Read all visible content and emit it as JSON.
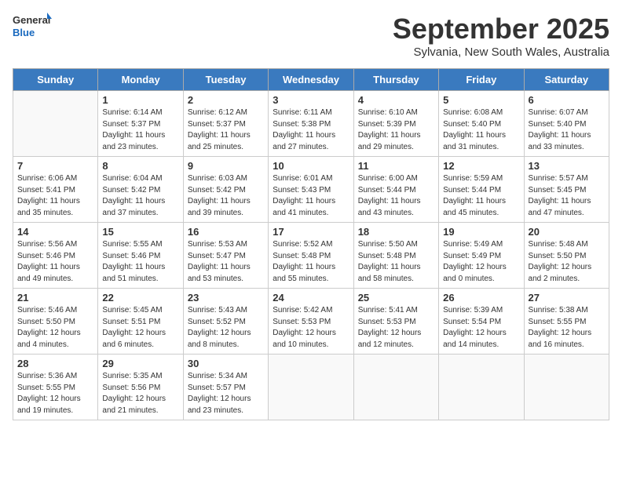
{
  "header": {
    "logo_general": "General",
    "logo_blue": "Blue",
    "month_title": "September 2025",
    "location": "Sylvania, New South Wales, Australia"
  },
  "weekdays": [
    "Sunday",
    "Monday",
    "Tuesday",
    "Wednesday",
    "Thursday",
    "Friday",
    "Saturday"
  ],
  "weeks": [
    [
      {
        "day": "",
        "info": ""
      },
      {
        "day": "1",
        "info": "Sunrise: 6:14 AM\nSunset: 5:37 PM\nDaylight: 11 hours\nand 23 minutes."
      },
      {
        "day": "2",
        "info": "Sunrise: 6:12 AM\nSunset: 5:37 PM\nDaylight: 11 hours\nand 25 minutes."
      },
      {
        "day": "3",
        "info": "Sunrise: 6:11 AM\nSunset: 5:38 PM\nDaylight: 11 hours\nand 27 minutes."
      },
      {
        "day": "4",
        "info": "Sunrise: 6:10 AM\nSunset: 5:39 PM\nDaylight: 11 hours\nand 29 minutes."
      },
      {
        "day": "5",
        "info": "Sunrise: 6:08 AM\nSunset: 5:40 PM\nDaylight: 11 hours\nand 31 minutes."
      },
      {
        "day": "6",
        "info": "Sunrise: 6:07 AM\nSunset: 5:40 PM\nDaylight: 11 hours\nand 33 minutes."
      }
    ],
    [
      {
        "day": "7",
        "info": "Sunrise: 6:06 AM\nSunset: 5:41 PM\nDaylight: 11 hours\nand 35 minutes."
      },
      {
        "day": "8",
        "info": "Sunrise: 6:04 AM\nSunset: 5:42 PM\nDaylight: 11 hours\nand 37 minutes."
      },
      {
        "day": "9",
        "info": "Sunrise: 6:03 AM\nSunset: 5:42 PM\nDaylight: 11 hours\nand 39 minutes."
      },
      {
        "day": "10",
        "info": "Sunrise: 6:01 AM\nSunset: 5:43 PM\nDaylight: 11 hours\nand 41 minutes."
      },
      {
        "day": "11",
        "info": "Sunrise: 6:00 AM\nSunset: 5:44 PM\nDaylight: 11 hours\nand 43 minutes."
      },
      {
        "day": "12",
        "info": "Sunrise: 5:59 AM\nSunset: 5:44 PM\nDaylight: 11 hours\nand 45 minutes."
      },
      {
        "day": "13",
        "info": "Sunrise: 5:57 AM\nSunset: 5:45 PM\nDaylight: 11 hours\nand 47 minutes."
      }
    ],
    [
      {
        "day": "14",
        "info": "Sunrise: 5:56 AM\nSunset: 5:46 PM\nDaylight: 11 hours\nand 49 minutes."
      },
      {
        "day": "15",
        "info": "Sunrise: 5:55 AM\nSunset: 5:46 PM\nDaylight: 11 hours\nand 51 minutes."
      },
      {
        "day": "16",
        "info": "Sunrise: 5:53 AM\nSunset: 5:47 PM\nDaylight: 11 hours\nand 53 minutes."
      },
      {
        "day": "17",
        "info": "Sunrise: 5:52 AM\nSunset: 5:48 PM\nDaylight: 11 hours\nand 55 minutes."
      },
      {
        "day": "18",
        "info": "Sunrise: 5:50 AM\nSunset: 5:48 PM\nDaylight: 11 hours\nand 58 minutes."
      },
      {
        "day": "19",
        "info": "Sunrise: 5:49 AM\nSunset: 5:49 PM\nDaylight: 12 hours\nand 0 minutes."
      },
      {
        "day": "20",
        "info": "Sunrise: 5:48 AM\nSunset: 5:50 PM\nDaylight: 12 hours\nand 2 minutes."
      }
    ],
    [
      {
        "day": "21",
        "info": "Sunrise: 5:46 AM\nSunset: 5:50 PM\nDaylight: 12 hours\nand 4 minutes."
      },
      {
        "day": "22",
        "info": "Sunrise: 5:45 AM\nSunset: 5:51 PM\nDaylight: 12 hours\nand 6 minutes."
      },
      {
        "day": "23",
        "info": "Sunrise: 5:43 AM\nSunset: 5:52 PM\nDaylight: 12 hours\nand 8 minutes."
      },
      {
        "day": "24",
        "info": "Sunrise: 5:42 AM\nSunset: 5:53 PM\nDaylight: 12 hours\nand 10 minutes."
      },
      {
        "day": "25",
        "info": "Sunrise: 5:41 AM\nSunset: 5:53 PM\nDaylight: 12 hours\nand 12 minutes."
      },
      {
        "day": "26",
        "info": "Sunrise: 5:39 AM\nSunset: 5:54 PM\nDaylight: 12 hours\nand 14 minutes."
      },
      {
        "day": "27",
        "info": "Sunrise: 5:38 AM\nSunset: 5:55 PM\nDaylight: 12 hours\nand 16 minutes."
      }
    ],
    [
      {
        "day": "28",
        "info": "Sunrise: 5:36 AM\nSunset: 5:55 PM\nDaylight: 12 hours\nand 19 minutes."
      },
      {
        "day": "29",
        "info": "Sunrise: 5:35 AM\nSunset: 5:56 PM\nDaylight: 12 hours\nand 21 minutes."
      },
      {
        "day": "30",
        "info": "Sunrise: 5:34 AM\nSunset: 5:57 PM\nDaylight: 12 hours\nand 23 minutes."
      },
      {
        "day": "",
        "info": ""
      },
      {
        "day": "",
        "info": ""
      },
      {
        "day": "",
        "info": ""
      },
      {
        "day": "",
        "info": ""
      }
    ]
  ]
}
